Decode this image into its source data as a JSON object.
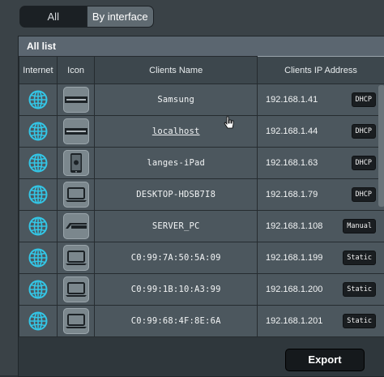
{
  "tabs": {
    "all": "All",
    "by_interface": "By interface"
  },
  "panel": {
    "title": "All list"
  },
  "columns": {
    "internet": "Internet",
    "icon": "Icon",
    "name": "Clients Name",
    "ip": "Clients IP Address"
  },
  "clients": [
    {
      "name": "Samsung",
      "ip": "192.168.1.41",
      "type": "DHCP",
      "device_icon": "samsung-logo-icon"
    },
    {
      "name": "localhost",
      "ip": "192.168.1.44",
      "type": "DHCP",
      "device_icon": "samsung-logo-icon"
    },
    {
      "name": "langes-iPad",
      "ip": "192.168.1.63",
      "type": "DHCP",
      "device_icon": "apple-ipad-icon"
    },
    {
      "name": "DESKTOP-HDSB7I8",
      "ip": "192.168.1.79",
      "type": "DHCP",
      "device_icon": "laptop-icon"
    },
    {
      "name": "SERVER_PC",
      "ip": "192.168.1.108",
      "type": "Manual",
      "device_icon": "asus-logo-icon"
    },
    {
      "name": "C0:99:7A:50:5A:09",
      "ip": "192.168.1.199",
      "type": "Static",
      "device_icon": "laptop-icon"
    },
    {
      "name": "C0:99:1B:10:A3:99",
      "ip": "192.168.1.200",
      "type": "Static",
      "device_icon": "laptop-icon"
    },
    {
      "name": "C0:99:68:4F:8E:6A",
      "ip": "192.168.1.201",
      "type": "Static",
      "device_icon": "laptop-icon"
    }
  ],
  "actions": {
    "export": "Export"
  },
  "colors": {
    "globe": "#33c6e6",
    "panel_header": "#5b6670",
    "row": "#4c575e"
  }
}
